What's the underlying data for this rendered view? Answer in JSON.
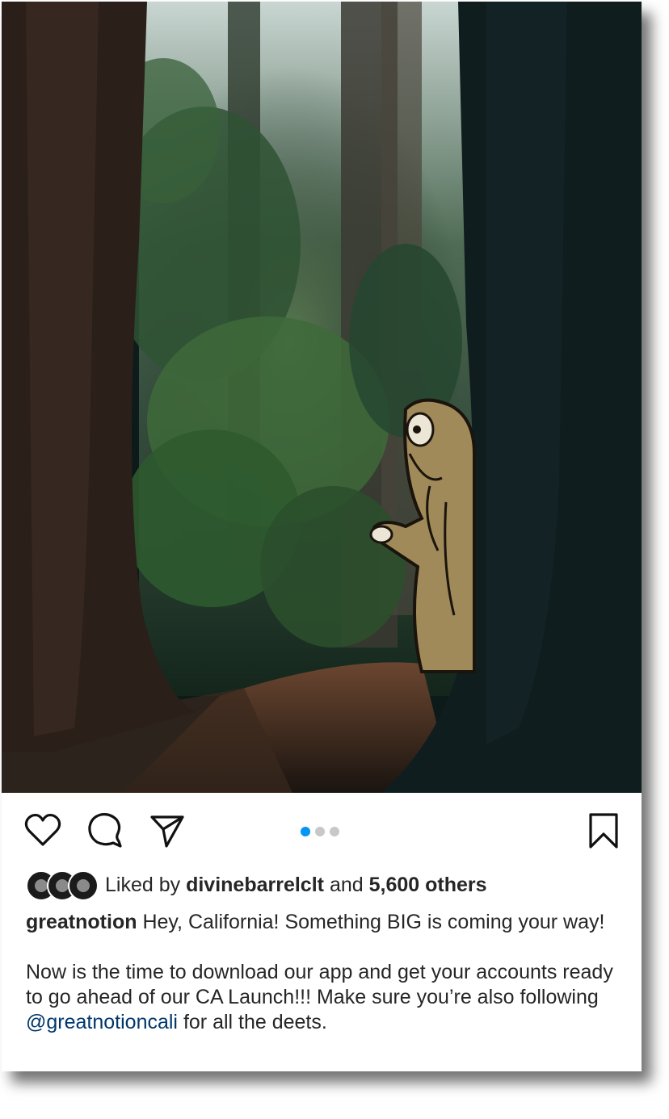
{
  "post": {
    "carousel": {
      "total": 3,
      "active_index": 0
    },
    "actions": {
      "like_icon": "heart-icon",
      "comment_icon": "comment-icon",
      "share_icon": "send-icon",
      "save_icon": "bookmark-icon"
    },
    "likes": {
      "prefix": "Liked by",
      "user": "divinebarrelclt",
      "joiner": "and",
      "count_text": "5,600 others"
    },
    "caption": {
      "username": "greatnotion",
      "line1": "Hey, California! Something BIG is coming your way!",
      "body_before": "Now is the time to download our app and get your accounts ready to go ahead of our CA Launch!!! Make sure you’re also following ",
      "mention": "@greatnotioncali",
      "body_after": " for all the deets."
    },
    "colors": {
      "accent_dot": "#0095f6",
      "mention": "#00376b",
      "text": "#262626"
    }
  }
}
